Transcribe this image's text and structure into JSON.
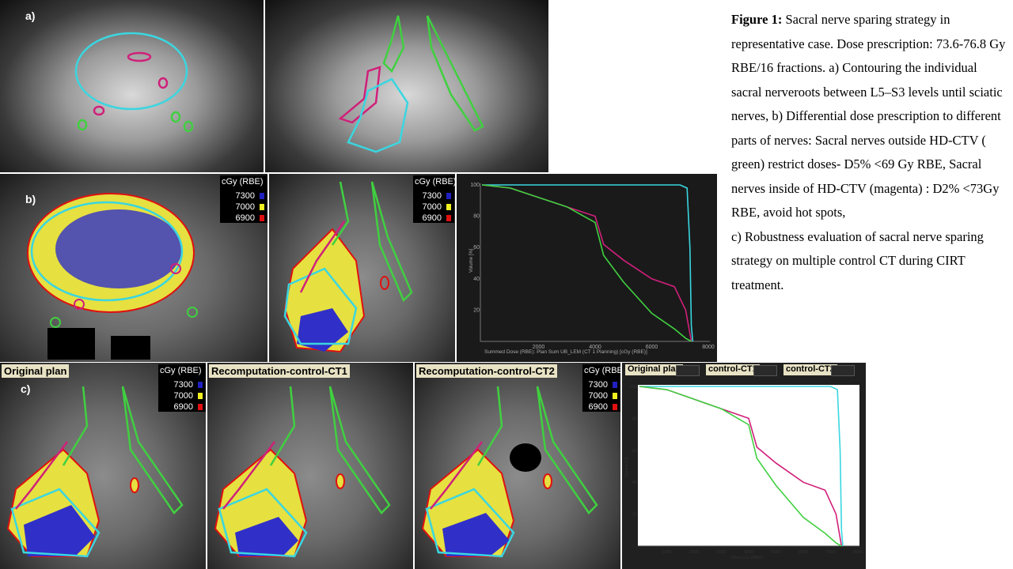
{
  "panels": {
    "a_label": "a)",
    "b_label": "b)",
    "c_label": "c)",
    "plan_titles": [
      "Original plan",
      "Recomputation-control-CT1",
      "Recomputation-control-CT2"
    ]
  },
  "dose_legend": {
    "unit": "cGy (RBE)",
    "levels": [
      {
        "value": "7300",
        "color": "#2020c0"
      },
      {
        "value": "7000",
        "color": "#f0f020"
      },
      {
        "value": "6900",
        "color": "#e01010"
      }
    ]
  },
  "contour_colors": {
    "hd_ctv": "#3ad6e0",
    "nerves_outside": "#40d040",
    "nerves_inside": "#d0207a"
  },
  "caption": {
    "heading": "Figure 1:",
    "text": "Sacral nerve sparing strategy in representative case. Dose prescription: 73.6-76.8 Gy RBE/16 fractions. a) Contouring the individual sacral nerveroots between L5–S3 levels until sciatic nerves, b) Differential dose prescription to different parts of nerves: Sacral nerves outside HD-CTV ( green) restrict doses- D5% <69 Gy RBE, Sacral nerves inside of HD-CTV (magenta) : D2% <73Gy RBE, avoid hot spots,",
    "text2": "c) Robustness evaluation of sacral nerve sparing strategy on multiple control CT during CIRT treatment."
  },
  "dvh_top": {
    "xlabel": "Summed Dose (RBE): Plan Sum UB_LEM (CT 1 Planning) [cGy (RBE)]",
    "ylabel": "Volume [%]"
  },
  "dvh_bottom": {
    "legend": [
      "Original plan",
      "control-CT1",
      "control-CT2"
    ],
    "xlabel": "Dose [cGy (RBE)]",
    "ylabel": "Volume [%]"
  },
  "chart_data": [
    {
      "type": "line",
      "xlim": [
        0,
        8000
      ],
      "ylim": [
        0,
        100
      ],
      "xticks": [
        2000,
        4000,
        6000,
        8000
      ],
      "yticks": [
        20,
        40,
        60,
        80,
        100
      ],
      "series": [
        {
          "color": "#3ad6e0",
          "x": [
            0,
            2000,
            4000,
            6000,
            7000,
            7250,
            7350,
            7400,
            7450
          ],
          "y": [
            100,
            100,
            100,
            100,
            100,
            98,
            60,
            10,
            0
          ]
        },
        {
          "color": "#d0207a",
          "x": [
            0,
            1000,
            2000,
            3000,
            4000,
            4300,
            5000,
            6000,
            6800,
            7200,
            7400
          ],
          "y": [
            100,
            98,
            92,
            86,
            80,
            62,
            52,
            40,
            35,
            20,
            0
          ]
        },
        {
          "color": "#40d040",
          "x": [
            0,
            1000,
            2000,
            3000,
            4000,
            4300,
            5000,
            6000,
            6800,
            7200,
            7400
          ],
          "y": [
            100,
            98,
            92,
            86,
            76,
            55,
            38,
            18,
            8,
            2,
            0
          ]
        }
      ],
      "grid": false
    },
    {
      "type": "line",
      "xlim": [
        0,
        8000
      ],
      "ylim": [
        0,
        100
      ],
      "xticks": [
        1000,
        2000,
        3000,
        4000,
        5000,
        6000,
        7000,
        8000
      ],
      "yticks": [
        20,
        40,
        60,
        80,
        100
      ],
      "series": [
        {
          "name": "Original plan",
          "color": "#3ad6e0",
          "x": [
            0,
            2000,
            4000,
            6000,
            7000,
            7250,
            7350,
            7400,
            7450
          ],
          "y": [
            100,
            100,
            100,
            100,
            100,
            98,
            60,
            10,
            0
          ]
        },
        {
          "name": "Original plan",
          "color": "#d0207a",
          "x": [
            0,
            1000,
            2000,
            3000,
            4000,
            4300,
            5000,
            6000,
            6800,
            7200,
            7400
          ],
          "y": [
            100,
            98,
            92,
            86,
            80,
            62,
            52,
            40,
            35,
            20,
            0
          ]
        },
        {
          "name": "Original plan",
          "color": "#40d040",
          "x": [
            0,
            1000,
            2000,
            3000,
            4000,
            4300,
            5000,
            6000,
            6800,
            7200,
            7400
          ],
          "y": [
            100,
            98,
            92,
            86,
            76,
            55,
            38,
            18,
            8,
            2,
            0
          ]
        }
      ],
      "grid": false
    }
  ]
}
